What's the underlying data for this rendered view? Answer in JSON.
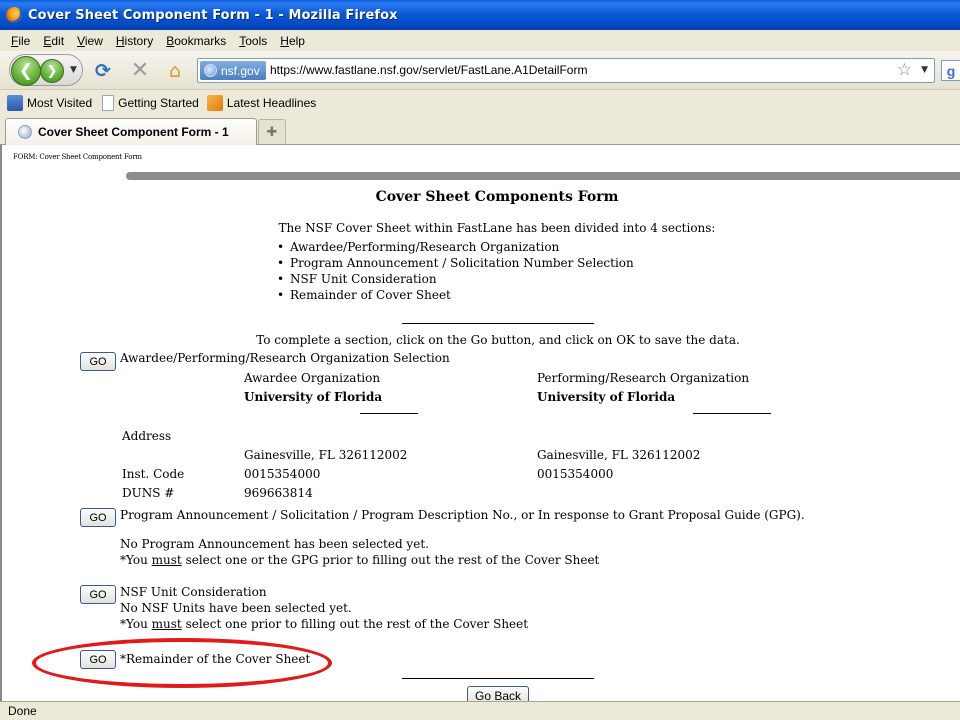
{
  "window": {
    "title": "Cover Sheet Component Form - 1 - Mozilla Firefox"
  },
  "menu": [
    {
      "label": "File"
    },
    {
      "label": "Edit"
    },
    {
      "label": "View"
    },
    {
      "label": "History"
    },
    {
      "label": "Bookmarks"
    },
    {
      "label": "Tools"
    },
    {
      "label": "Help"
    }
  ],
  "navbar": {
    "identity_label": "nsf.gov",
    "url": "https://www.fastlane.nsf.gov/servlet/FastLane.A1DetailForm",
    "search_engine_glyph": "g"
  },
  "bookmarks": [
    {
      "label": "Most Visited",
      "icon": "most-visited-icon"
    },
    {
      "label": "Getting Started",
      "icon": "page-icon"
    },
    {
      "label": "Latest Headlines",
      "icon": "rss-feed-icon"
    }
  ],
  "tabs": [
    {
      "label": "Cover Sheet Component Form - 1",
      "active": true
    }
  ],
  "page": {
    "breadcrumb": "FORM: Cover Sheet Component Form",
    "title": "Cover Sheet Components Form",
    "intro": "The NSF Cover Sheet within FastLane has been divided into 4 sections:",
    "sections_list": [
      "Awardee/Performing/Research Organization",
      "Program Announcement / Solicitation Number Selection",
      "NSF Unit Consideration",
      "Remainder of Cover Sheet"
    ],
    "instructions": "To complete a section, click on the Go button, and click on OK to save the data.",
    "go_label": "GO",
    "org_section": {
      "heading": "Awardee/Performing/Research Organization Selection",
      "awardee_header": "Awardee Organization",
      "performing_header": "Performing/Research Organization",
      "awardee_name": "University of Florida",
      "performing_name": "University of Florida",
      "address_label": "Address",
      "awardee_address": "Gainesville, FL 326112002",
      "performing_address": "Gainesville, FL 326112002",
      "inst_code_label": "Inst. Code",
      "awardee_inst_code": "0015354000",
      "performing_inst_code": "0015354000",
      "duns_label": "DUNS #",
      "awardee_duns": "969663814"
    },
    "program_section": {
      "heading": "Program Announcement / Solicitation / Program Description No., or In response to Grant Proposal Guide (GPG).",
      "status": "No Program Announcement has been selected yet.",
      "note_prefix": "*You ",
      "note_emphasis": "must",
      "note_suffix": " select one or the GPG prior to filling out the rest of the Cover Sheet"
    },
    "unit_section": {
      "heading": "NSF Unit Consideration",
      "status": "No NSF Units have been selected yet.",
      "note_prefix": "*You ",
      "note_emphasis": "must",
      "note_suffix": " select one prior to filling out the rest of the Cover Sheet"
    },
    "remainder_section": {
      "heading": "*Remainder of the Cover Sheet",
      "highlight_color": "#e01b1b"
    },
    "go_back_label": "Go Back"
  },
  "status": {
    "text": "Done"
  }
}
